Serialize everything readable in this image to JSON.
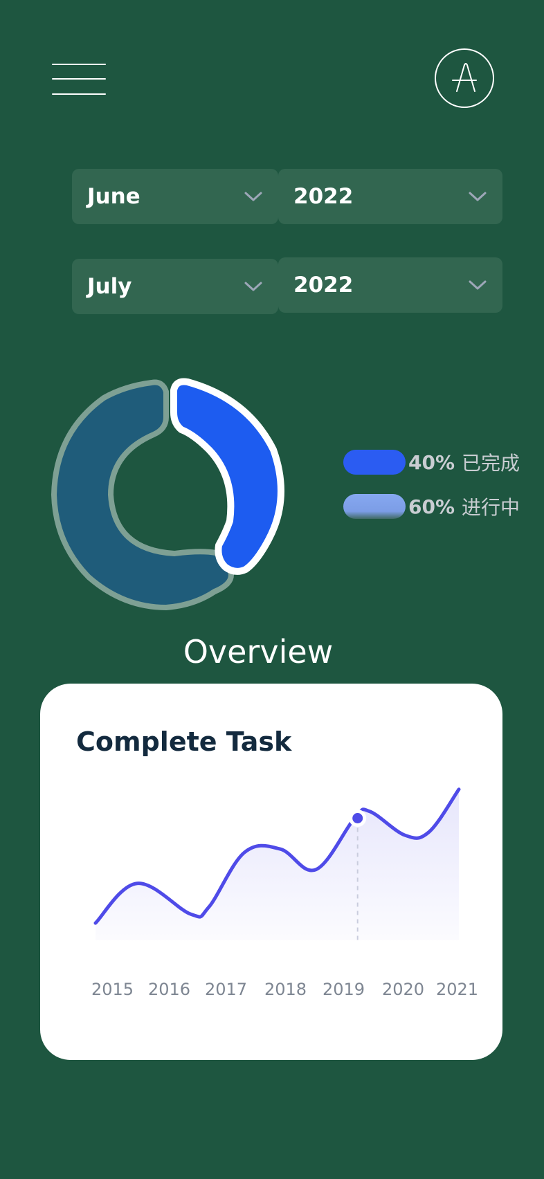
{
  "header": {
    "menu_icon": "hamburger-menu-icon",
    "avatar_icon": "logo-a-icon"
  },
  "filters": {
    "start": {
      "month": "June",
      "year": "2022"
    },
    "end": {
      "month": "July",
      "year": "2022"
    }
  },
  "donut": {
    "legend": [
      {
        "percent": "40%",
        "label": "已完成",
        "color": "#2B5CF2"
      },
      {
        "percent": "60%",
        "label": "进行中",
        "color": "#7FA0EA"
      }
    ]
  },
  "section_title": "Overview",
  "card": {
    "title": "Complete Task"
  },
  "colors": {
    "background": "#1E5640",
    "select": "#326650",
    "line": "#4F4BE8",
    "donut_done": "#1D5CF0",
    "donut_progress": "#1F5C7A"
  },
  "chart_data": {
    "type": "line",
    "title": "Complete Task",
    "categories": [
      "2015",
      "2016",
      "2017",
      "2018",
      "2019",
      "2020",
      "2021"
    ],
    "x": [
      2014.7,
      2015.4,
      2016.3,
      2016.6,
      2017.2,
      2017.8,
      2018.4,
      2019.05,
      2019.3,
      2019.9,
      2020.3,
      2020.8
    ],
    "values": [
      17,
      75,
      30,
      40,
      120,
      125,
      95,
      170,
      180,
      145,
      150,
      212
    ],
    "highlight": {
      "x": 2019.1,
      "value": 170
    },
    "ylim": [
      0,
      230
    ],
    "grid": false,
    "legend": "none"
  }
}
